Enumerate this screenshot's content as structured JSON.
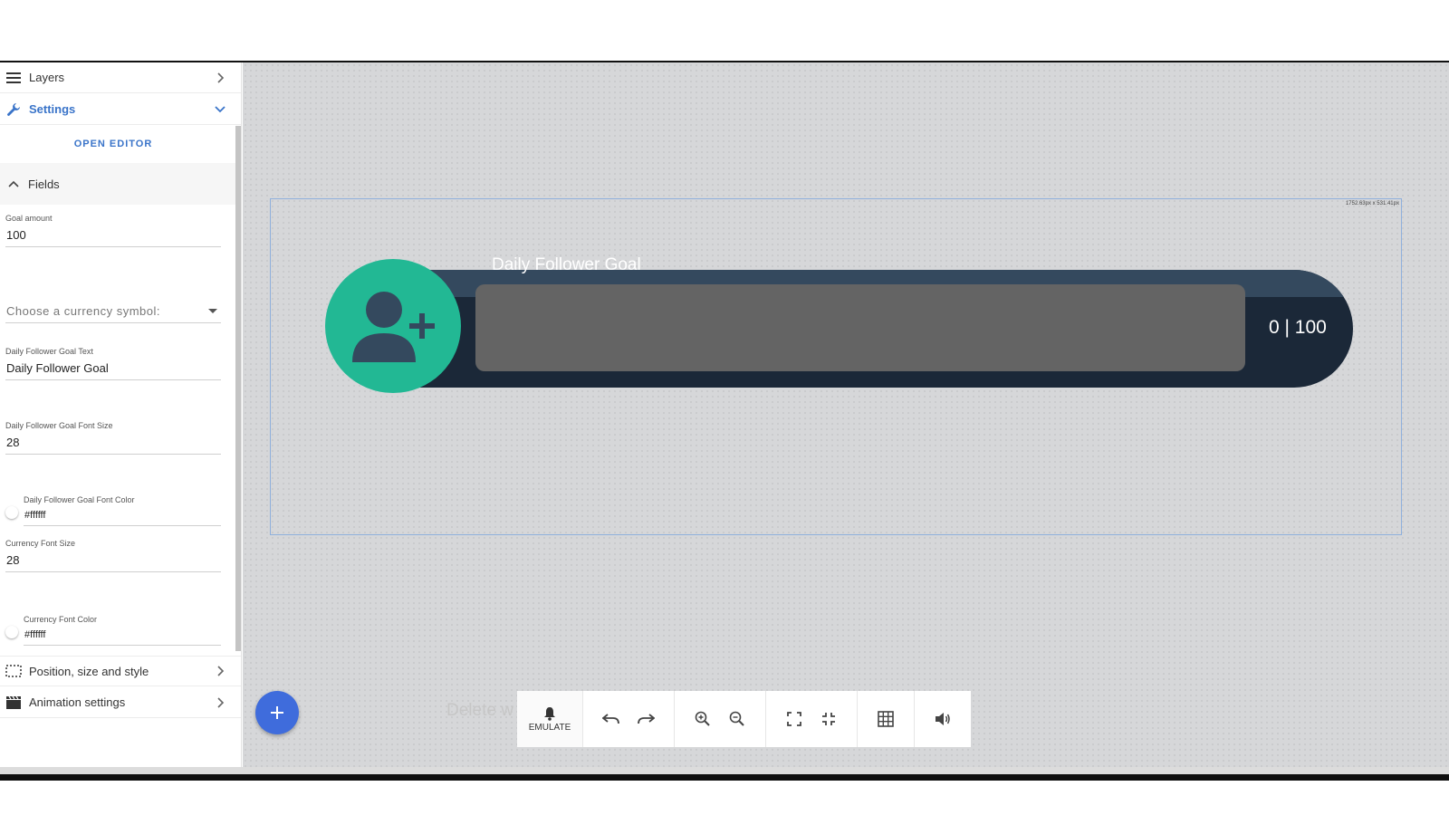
{
  "sidebar": {
    "layers_label": "Layers",
    "settings_label": "Settings",
    "open_editor": "OPEN EDITOR",
    "fields_label": "Fields",
    "fields": {
      "goal_amount_label": "Goal amount",
      "goal_amount_value": "100",
      "currency_placeholder": "Choose a currency symbol:",
      "goal_text_label": "Daily Follower Goal Text",
      "goal_text_value": "Daily Follower Goal",
      "goal_font_size_label": "Daily Follower Goal Font Size",
      "goal_font_size_value": "28",
      "goal_font_color_label": "Daily Follower Goal Font Color",
      "goal_font_color_value": "#ffffff",
      "currency_font_size_label": "Currency Font Size",
      "currency_font_size_value": "28",
      "currency_font_color_label": "Currency Font Color",
      "currency_font_color_value": "#ffffff"
    },
    "position_label": "Position, size and style",
    "animation_label": "Animation settings"
  },
  "canvas": {
    "dimensions": "1752.63px x 531.41px",
    "widget": {
      "title": "Daily Follower Goal",
      "count": "0 | 100",
      "progress_fraction": 0
    },
    "delete_text": "Delete w"
  },
  "toolbar": {
    "emulate_label": "EMULATE"
  },
  "colors": {
    "accent": "#3a74c9",
    "fab": "#3f6cdc",
    "avatar_bg": "#22b894",
    "bar_dark": "#1b2838",
    "bar_inner": "#646464"
  },
  "icons": [
    "menu-icon",
    "wrench-icon",
    "chevron-right-icon",
    "chevron-down-icon",
    "chevron-up-icon",
    "add-user-icon",
    "plus-icon",
    "bell-icon",
    "undo-icon",
    "redo-icon",
    "zoom-in-icon",
    "zoom-out-icon",
    "fullscreen-icon",
    "exit-fullscreen-icon",
    "grid-icon",
    "volume-icon"
  ]
}
